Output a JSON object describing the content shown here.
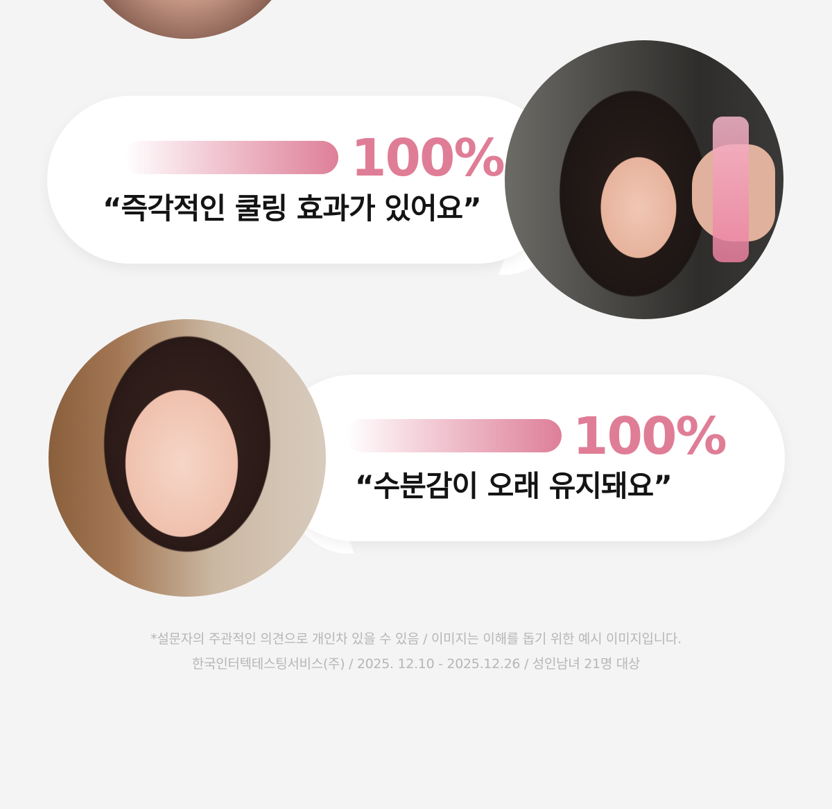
{
  "reviews": [
    {
      "percent": "100%",
      "quote": "“즉각적인 쿨링 효과가 있어요”"
    },
    {
      "percent": "100%",
      "quote": "“수분감이 오래 유지돼요”"
    }
  ],
  "disclaimer": {
    "line1": "*설문자의 주관적인 의견으로 개인차 있을 수 있음 / 이미지는 이해를 돕기 위한 예시 이미지입니다.",
    "line2": "한국인터텍테스팅서비스(주) / 2025. 12.10 - 2025.12.26 / 성인남녀 21명 대상"
  },
  "colors": {
    "accent": "#e07d96",
    "background": "#f4f4f4",
    "text": "#141414",
    "muted": "#b6b6b6"
  }
}
